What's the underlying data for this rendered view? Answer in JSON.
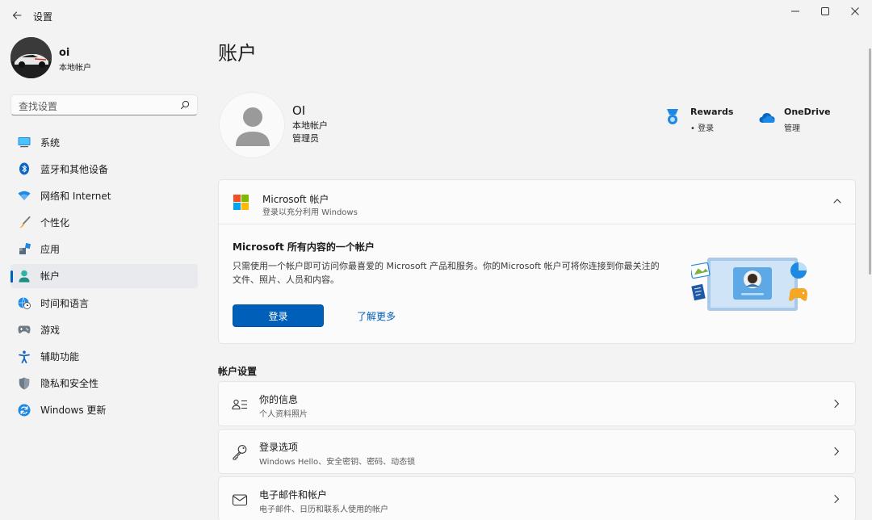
{
  "app": {
    "title": "设置",
    "back_icon": "arrow-left-icon"
  },
  "window_controls": {
    "minimize_icon": "minimize-icon",
    "maximize_icon": "maximize-icon",
    "close_icon": "close-icon"
  },
  "profile": {
    "name": "oi",
    "account_type": "本地帐户"
  },
  "search": {
    "placeholder": "查找设置",
    "icon": "search-icon"
  },
  "sidebar": {
    "items": [
      {
        "label": "系统",
        "icon": "system-display-icon",
        "active": false
      },
      {
        "label": "蓝牙和其他设备",
        "icon": "bluetooth-icon",
        "active": false
      },
      {
        "label": "网络和 Internet",
        "icon": "wifi-icon",
        "active": false
      },
      {
        "label": "个性化",
        "icon": "paintbrush-icon",
        "active": false
      },
      {
        "label": "应用",
        "icon": "apps-icon",
        "active": false
      },
      {
        "label": "帐户",
        "icon": "person-icon",
        "active": true
      },
      {
        "label": "时间和语言",
        "icon": "globe-clock-icon",
        "active": false
      },
      {
        "label": "游戏",
        "icon": "gamepad-icon",
        "active": false
      },
      {
        "label": "辅助功能",
        "icon": "accessibility-icon",
        "active": false
      },
      {
        "label": "隐私和安全性",
        "icon": "shield-icon",
        "active": false
      },
      {
        "label": "Windows 更新",
        "icon": "update-icon",
        "active": false
      }
    ]
  },
  "main": {
    "page_title": "账户",
    "account": {
      "name": "OI",
      "type": "本地帐户",
      "role": "管理员"
    },
    "rewards": {
      "title": "Rewards",
      "sub": "• 登录"
    },
    "onedrive": {
      "title": "OneDrive",
      "sub": "管理"
    },
    "ms_card": {
      "title": "Microsoft 帐户",
      "subtitle": "登录以充分利用 Windows",
      "body_title": "Microsoft 所有内容的一个帐户",
      "body_text": "只需使用一个帐户即可访问你最喜爱的 Microsoft 产品和服务。你的Microsoft 帐户可将你连接到你最关注的文件、照片、人员和内容。",
      "signin_label": "登录",
      "learn_more_label": "了解更多"
    },
    "section_title": "帐户设置",
    "rows": [
      {
        "title": "你的信息",
        "sub": "个人资料照片",
        "icon": "id-card-icon"
      },
      {
        "title": "登录选项",
        "sub": "Windows Hello、安全密钥、密码、动态锁",
        "icon": "key-icon"
      },
      {
        "title": "电子邮件和帐户",
        "sub": "电子邮件、日历和联系人使用的帐户",
        "icon": "mail-icon"
      }
    ]
  },
  "colors": {
    "accent": "#005fb8",
    "background": "#f3f3f3",
    "card": "#fbfbfb"
  }
}
